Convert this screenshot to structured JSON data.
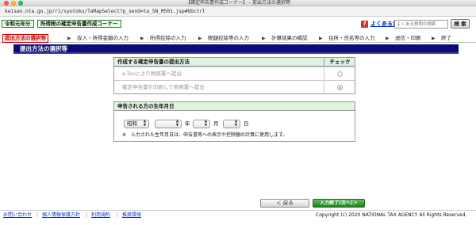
{
  "window": {
    "title": "【確定申告書作成コーナー】 - 提出方法の選択等"
  },
  "browser": {
    "url": "keisan.nta.go.jp/r1/syotoku/TaMapSelect?p_send=ta_SN_M501.jsp#bbctrl"
  },
  "header": {
    "era_badge": "令和元年分",
    "corner_badge": "所得税の確定申告書作成コーナー",
    "faq_icon": "?",
    "faq_link": "よくある質問",
    "search_placeholder": "よくある質問の検索",
    "search_button": "検 索"
  },
  "steps": {
    "items": [
      "提出方法の選択等",
      "収入・所得金額の入力",
      "所得控除の入力",
      "税額控除等の入力",
      "計算結果の確認",
      "住所・氏名等の入力",
      "送信・印刷",
      "終了"
    ],
    "current_index": 0
  },
  "page_title": "提出方法の選択等",
  "submission": {
    "heading": "作成する確定申告書の提出方法",
    "check_heading": "チェック",
    "options": [
      {
        "label": "e-Taxにより税務署へ提出",
        "selected": false
      },
      {
        "label": "確定申告書を印刷して税務署へ提出",
        "selected": true
      }
    ]
  },
  "birthdate": {
    "heading": "申告される方の生年月日",
    "era_value": "昭和",
    "year_value": "",
    "month_value": "",
    "day_value": "",
    "year_unit": "年",
    "month_unit": "月",
    "day_unit": "日",
    "note": "※　入力された生年月日は、申告書等への表示や控除額の計算に使用します。"
  },
  "nav": {
    "back": "＜ 戻る",
    "next": "入力終了(次へ)＞"
  },
  "footer": {
    "links": [
      "お問い合わせ",
      "個人情報保護方針",
      "利用規約",
      "推奨環境"
    ],
    "copyright": "Copyright (c) 2020 NATIONAL TAX AGENCY All Rights Reserved."
  },
  "colors": {
    "page_bar": "#0c0c78",
    "panel_header": "#dff3df",
    "current_step": "#cc0000",
    "next_button": "#2e8b2e"
  }
}
